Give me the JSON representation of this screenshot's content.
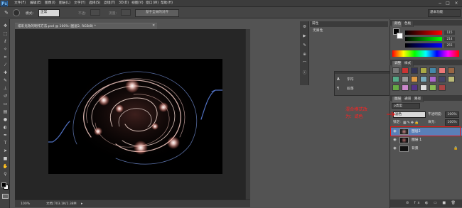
{
  "menubar": {
    "app_logo": "Ps",
    "items": [
      "文件(F)",
      "编辑(E)",
      "图像(I)",
      "图层(L)",
      "文字(Y)",
      "选择(S)",
      "滤镜(T)",
      "3D(D)",
      "视图(V)",
      "窗口(W)",
      "帮助(H)"
    ],
    "window_controls": [
      "−",
      "□",
      "×"
    ]
  },
  "options_bar": {
    "mode_label": "模式:",
    "mode_value": "正常",
    "opacity_label": "不透:",
    "flow_label": "流量:",
    "align_button": "基于全局的对齐",
    "workspace": "基本功能"
  },
  "toolbar": {
    "tools": [
      "move",
      "marquee",
      "lasso",
      "quick-select",
      "crop",
      "eyedropper",
      "healing",
      "brush",
      "stamp",
      "history-brush",
      "eraser",
      "gradient",
      "blur",
      "dodge",
      "pen",
      "type",
      "path-select",
      "shape",
      "hand",
      "zoom"
    ]
  },
  "document": {
    "tab_title": "炫彩光效的制作方法.psd @ 100% (图层2, RGB/8) *",
    "zoom": "100%",
    "doc_size": "文档:703.1K/1.38M"
  },
  "properties": {
    "header": "属性",
    "title": "无属性"
  },
  "float_panel": {
    "items": [
      "字符",
      "段落"
    ]
  },
  "color_panel": {
    "tabs": [
      "颜色",
      "色板"
    ],
    "r": "115",
    "g": "214",
    "b": "255"
  },
  "adjust_panel": {
    "tabs": [
      "调整",
      "样式"
    ]
  },
  "layers_panel": {
    "tabs": [
      "图层",
      "通道",
      "路径"
    ],
    "filter_label": "ρ类型",
    "blend_mode": "滤色",
    "opacity_label": "不透明度:",
    "opacity_value": "100%",
    "lock_label": "锁定:",
    "fill_label": "填充:",
    "fill_value": "100%",
    "layers": [
      {
        "name": "图层2",
        "selected": true
      },
      {
        "name": "图层 1",
        "selected": false
      },
      {
        "name": "背景",
        "selected": false
      }
    ]
  },
  "annotation": {
    "line1": "混合模式改",
    "line2": "为：滤色"
  },
  "colors": {
    "accent_red": "#e11111",
    "layer_selected": "#5a7fb8",
    "panel_bg": "#535353"
  }
}
